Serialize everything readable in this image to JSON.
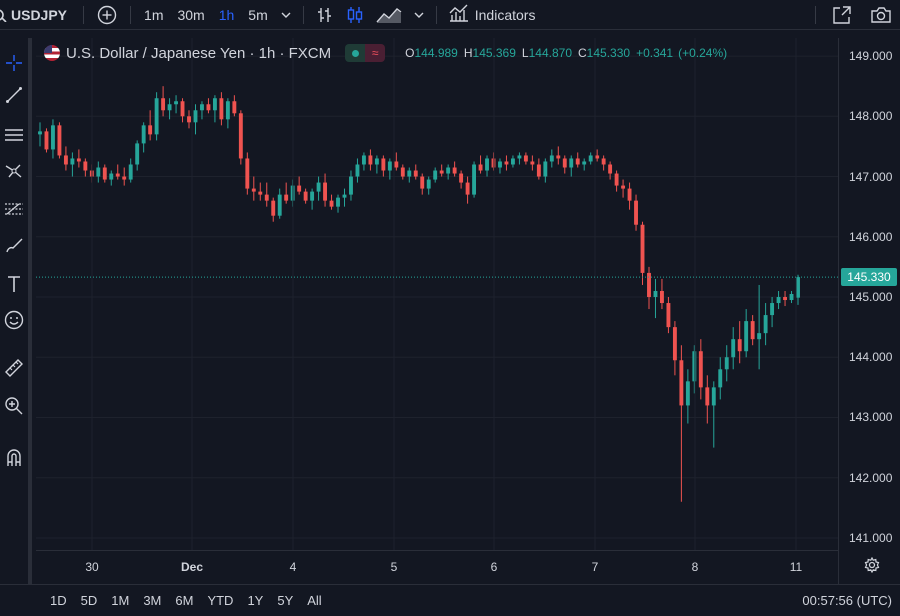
{
  "toolbar": {
    "symbol": "USDJPY",
    "intervals": [
      {
        "label": "1m",
        "active": false
      },
      {
        "label": "30m",
        "active": false
      },
      {
        "label": "1h",
        "active": true
      },
      {
        "label": "5m",
        "active": false
      }
    ],
    "indicators_label": "Indicators",
    "icons": [
      "search-icon",
      "add-symbol-icon",
      "intervals-dropdown-icon",
      "bar-style-icon",
      "candle-style-icon",
      "area-style-icon",
      "chart-style-dropdown-icon",
      "indicators-icon",
      "fullscreen-icon",
      "camera-icon"
    ]
  },
  "left_toolbar": {
    "icons": [
      "crosshair-icon",
      "trend-line-icon",
      "horizontal-lines-icon",
      "pattern-icon",
      "fib-icon",
      "brush-icon",
      "text-icon",
      "emoji-icon",
      "ruler-icon",
      "zoom-icon",
      "magnet-icon"
    ]
  },
  "legend": {
    "title": "U.S. Dollar / Japanese Yen · 1h · FXCM",
    "delay_glyph": "≈",
    "open_label": "O",
    "open": "144.989",
    "high_label": "H",
    "high": "145.369",
    "low_label": "L",
    "low": "144.870",
    "close_label": "C",
    "close": "145.330",
    "change": "+0.341",
    "change_pct": "(+0.24%)"
  },
  "colors": {
    "up": "#26a69a",
    "down": "#ef5350",
    "background": "#131722",
    "grid": "#1e222d",
    "text": "#d1d4dc",
    "accent": "#2962ff"
  },
  "chart_data": {
    "type": "candlestick",
    "title": "U.S. Dollar / Japanese Yen · 1h · FXCM",
    "xlabel": "",
    "ylabel": "",
    "x_ticks": [
      "30",
      "Dec",
      "4",
      "5",
      "6",
      "7",
      "8",
      "11"
    ],
    "y_ticks": [
      "149.000",
      "148.000",
      "147.000",
      "146.000",
      "145.000",
      "144.000",
      "143.000",
      "142.000",
      "141.000"
    ],
    "ylim": [
      140.8,
      149.3
    ],
    "last_price": "145.330",
    "grid": true,
    "series": [
      {
        "o": 147.7,
        "h": 147.9,
        "l": 147.5,
        "c": 147.75
      },
      {
        "o": 147.75,
        "h": 147.8,
        "l": 147.4,
        "c": 147.45
      },
      {
        "o": 147.45,
        "h": 147.95,
        "l": 147.3,
        "c": 147.85
      },
      {
        "o": 147.85,
        "h": 147.9,
        "l": 147.3,
        "c": 147.35
      },
      {
        "o": 147.35,
        "h": 147.5,
        "l": 147.1,
        "c": 147.2
      },
      {
        "o": 147.2,
        "h": 147.4,
        "l": 147.0,
        "c": 147.3
      },
      {
        "o": 147.3,
        "h": 147.45,
        "l": 147.15,
        "c": 147.25
      },
      {
        "o": 147.25,
        "h": 147.3,
        "l": 147.0,
        "c": 147.1
      },
      {
        "o": 147.1,
        "h": 147.2,
        "l": 146.9,
        "c": 147.0
      },
      {
        "o": 147.0,
        "h": 147.25,
        "l": 146.9,
        "c": 147.15
      },
      {
        "o": 147.15,
        "h": 147.2,
        "l": 146.9,
        "c": 146.95
      },
      {
        "o": 146.95,
        "h": 147.1,
        "l": 146.85,
        "c": 147.05
      },
      {
        "o": 147.05,
        "h": 147.2,
        "l": 146.95,
        "c": 147.0
      },
      {
        "o": 147.0,
        "h": 147.15,
        "l": 146.85,
        "c": 146.95
      },
      {
        "o": 146.95,
        "h": 147.3,
        "l": 146.9,
        "c": 147.2
      },
      {
        "o": 147.2,
        "h": 147.6,
        "l": 147.1,
        "c": 147.55
      },
      {
        "o": 147.55,
        "h": 147.9,
        "l": 147.4,
        "c": 147.85
      },
      {
        "o": 147.85,
        "h": 148.1,
        "l": 147.6,
        "c": 147.7
      },
      {
        "o": 147.7,
        "h": 148.4,
        "l": 147.6,
        "c": 148.3
      },
      {
        "o": 148.3,
        "h": 148.5,
        "l": 148.0,
        "c": 148.1
      },
      {
        "o": 148.1,
        "h": 148.3,
        "l": 147.95,
        "c": 148.2
      },
      {
        "o": 148.2,
        "h": 148.35,
        "l": 148.05,
        "c": 148.25
      },
      {
        "o": 148.25,
        "h": 148.3,
        "l": 147.9,
        "c": 148.0
      },
      {
        "o": 148.0,
        "h": 148.1,
        "l": 147.8,
        "c": 147.9
      },
      {
        "o": 147.9,
        "h": 148.2,
        "l": 147.7,
        "c": 148.1
      },
      {
        "o": 148.1,
        "h": 148.25,
        "l": 147.95,
        "c": 148.2
      },
      {
        "o": 148.2,
        "h": 148.3,
        "l": 148.05,
        "c": 148.1
      },
      {
        "o": 148.1,
        "h": 148.35,
        "l": 147.9,
        "c": 148.3
      },
      {
        "o": 148.3,
        "h": 148.4,
        "l": 147.85,
        "c": 147.95
      },
      {
        "o": 147.95,
        "h": 148.3,
        "l": 147.8,
        "c": 148.25
      },
      {
        "o": 148.25,
        "h": 148.35,
        "l": 148.0,
        "c": 148.05
      },
      {
        "o": 148.05,
        "h": 148.1,
        "l": 147.2,
        "c": 147.3
      },
      {
        "o": 147.3,
        "h": 147.4,
        "l": 146.7,
        "c": 146.8
      },
      {
        "o": 146.8,
        "h": 147.0,
        "l": 146.6,
        "c": 146.75
      },
      {
        "o": 146.75,
        "h": 146.9,
        "l": 146.6,
        "c": 146.7
      },
      {
        "o": 146.7,
        "h": 146.9,
        "l": 146.5,
        "c": 146.6
      },
      {
        "o": 146.6,
        "h": 146.65,
        "l": 146.25,
        "c": 146.35
      },
      {
        "o": 146.35,
        "h": 146.8,
        "l": 146.3,
        "c": 146.7
      },
      {
        "o": 146.7,
        "h": 146.9,
        "l": 146.55,
        "c": 146.6
      },
      {
        "o": 146.6,
        "h": 146.95,
        "l": 146.5,
        "c": 146.85
      },
      {
        "o": 146.85,
        "h": 147.0,
        "l": 146.7,
        "c": 146.75
      },
      {
        "o": 146.75,
        "h": 146.8,
        "l": 146.55,
        "c": 146.6
      },
      {
        "o": 146.6,
        "h": 146.8,
        "l": 146.45,
        "c": 146.75
      },
      {
        "o": 146.75,
        "h": 147.0,
        "l": 146.6,
        "c": 146.9
      },
      {
        "o": 146.9,
        "h": 147.05,
        "l": 146.5,
        "c": 146.6
      },
      {
        "o": 146.6,
        "h": 146.7,
        "l": 146.45,
        "c": 146.5
      },
      {
        "o": 146.5,
        "h": 146.7,
        "l": 146.4,
        "c": 146.65
      },
      {
        "o": 146.65,
        "h": 146.8,
        "l": 146.5,
        "c": 146.7
      },
      {
        "o": 146.7,
        "h": 147.1,
        "l": 146.6,
        "c": 147.0
      },
      {
        "o": 147.0,
        "h": 147.3,
        "l": 146.9,
        "c": 147.2
      },
      {
        "o": 147.2,
        "h": 147.4,
        "l": 147.1,
        "c": 147.35
      },
      {
        "o": 147.35,
        "h": 147.45,
        "l": 147.1,
        "c": 147.2
      },
      {
        "o": 147.2,
        "h": 147.35,
        "l": 147.05,
        "c": 147.3
      },
      {
        "o": 147.3,
        "h": 147.35,
        "l": 147.0,
        "c": 147.1
      },
      {
        "o": 147.1,
        "h": 147.3,
        "l": 146.95,
        "c": 147.25
      },
      {
        "o": 147.25,
        "h": 147.4,
        "l": 147.1,
        "c": 147.15
      },
      {
        "o": 147.15,
        "h": 147.2,
        "l": 146.95,
        "c": 147.0
      },
      {
        "o": 147.0,
        "h": 147.15,
        "l": 146.9,
        "c": 147.1
      },
      {
        "o": 147.1,
        "h": 147.2,
        "l": 146.95,
        "c": 147.0
      },
      {
        "o": 147.0,
        "h": 147.05,
        "l": 146.7,
        "c": 146.8
      },
      {
        "o": 146.8,
        "h": 147.0,
        "l": 146.7,
        "c": 146.95
      },
      {
        "o": 146.95,
        "h": 147.15,
        "l": 146.9,
        "c": 147.1
      },
      {
        "o": 147.1,
        "h": 147.2,
        "l": 147.0,
        "c": 147.05
      },
      {
        "o": 147.05,
        "h": 147.2,
        "l": 146.95,
        "c": 147.15
      },
      {
        "o": 147.15,
        "h": 147.25,
        "l": 147.0,
        "c": 147.05
      },
      {
        "o": 147.05,
        "h": 147.1,
        "l": 146.8,
        "c": 146.9
      },
      {
        "o": 146.9,
        "h": 147.0,
        "l": 146.55,
        "c": 146.7
      },
      {
        "o": 146.7,
        "h": 147.25,
        "l": 146.65,
        "c": 147.2
      },
      {
        "o": 147.2,
        "h": 147.35,
        "l": 147.05,
        "c": 147.1
      },
      {
        "o": 147.1,
        "h": 147.35,
        "l": 147.0,
        "c": 147.3
      },
      {
        "o": 147.3,
        "h": 147.4,
        "l": 147.1,
        "c": 147.15
      },
      {
        "o": 147.15,
        "h": 147.3,
        "l": 147.05,
        "c": 147.25
      },
      {
        "o": 147.25,
        "h": 147.35,
        "l": 147.1,
        "c": 147.2
      },
      {
        "o": 147.2,
        "h": 147.35,
        "l": 147.15,
        "c": 147.3
      },
      {
        "o": 147.3,
        "h": 147.4,
        "l": 147.2,
        "c": 147.35
      },
      {
        "o": 147.35,
        "h": 147.4,
        "l": 147.2,
        "c": 147.25
      },
      {
        "o": 147.25,
        "h": 147.35,
        "l": 147.1,
        "c": 147.2
      },
      {
        "o": 147.2,
        "h": 147.3,
        "l": 146.95,
        "c": 147.0
      },
      {
        "o": 147.0,
        "h": 147.3,
        "l": 146.9,
        "c": 147.25
      },
      {
        "o": 147.25,
        "h": 147.45,
        "l": 147.15,
        "c": 147.35
      },
      {
        "o": 147.35,
        "h": 147.5,
        "l": 147.2,
        "c": 147.3
      },
      {
        "o": 147.3,
        "h": 147.35,
        "l": 147.05,
        "c": 147.15
      },
      {
        "o": 147.15,
        "h": 147.35,
        "l": 147.0,
        "c": 147.3
      },
      {
        "o": 147.3,
        "h": 147.4,
        "l": 147.15,
        "c": 147.2
      },
      {
        "o": 147.2,
        "h": 147.3,
        "l": 147.1,
        "c": 147.25
      },
      {
        "o": 147.25,
        "h": 147.4,
        "l": 147.2,
        "c": 147.35
      },
      {
        "o": 147.35,
        "h": 147.45,
        "l": 147.25,
        "c": 147.3
      },
      {
        "o": 147.3,
        "h": 147.35,
        "l": 147.1,
        "c": 147.2
      },
      {
        "o": 147.2,
        "h": 147.25,
        "l": 146.95,
        "c": 147.05
      },
      {
        "o": 147.05,
        "h": 147.1,
        "l": 146.75,
        "c": 146.85
      },
      {
        "o": 146.85,
        "h": 146.95,
        "l": 146.65,
        "c": 146.8
      },
      {
        "o": 146.8,
        "h": 146.9,
        "l": 146.45,
        "c": 146.6
      },
      {
        "o": 146.6,
        "h": 146.7,
        "l": 146.1,
        "c": 146.2
      },
      {
        "o": 146.2,
        "h": 146.25,
        "l": 145.2,
        "c": 145.4
      },
      {
        "o": 145.4,
        "h": 145.5,
        "l": 144.8,
        "c": 145.0
      },
      {
        "o": 145.0,
        "h": 145.3,
        "l": 144.65,
        "c": 145.1
      },
      {
        "o": 145.1,
        "h": 145.3,
        "l": 144.8,
        "c": 144.9
      },
      {
        "o": 144.9,
        "h": 145.0,
        "l": 144.4,
        "c": 144.5
      },
      {
        "o": 144.5,
        "h": 144.6,
        "l": 143.7,
        "c": 143.95
      },
      {
        "o": 143.95,
        "h": 144.2,
        "l": 141.6,
        "c": 143.2
      },
      {
        "o": 143.2,
        "h": 143.8,
        "l": 142.9,
        "c": 143.6
      },
      {
        "o": 143.6,
        "h": 144.2,
        "l": 143.4,
        "c": 144.1
      },
      {
        "o": 144.1,
        "h": 144.3,
        "l": 143.3,
        "c": 143.5
      },
      {
        "o": 143.5,
        "h": 143.7,
        "l": 142.9,
        "c": 143.2
      },
      {
        "o": 143.2,
        "h": 143.6,
        "l": 142.5,
        "c": 143.5
      },
      {
        "o": 143.5,
        "h": 144.0,
        "l": 143.3,
        "c": 143.8
      },
      {
        "o": 143.8,
        "h": 144.2,
        "l": 143.6,
        "c": 144.0
      },
      {
        "o": 144.0,
        "h": 144.5,
        "l": 143.8,
        "c": 144.3
      },
      {
        "o": 144.3,
        "h": 144.6,
        "l": 143.9,
        "c": 144.1
      },
      {
        "o": 144.1,
        "h": 144.8,
        "l": 144.0,
        "c": 144.6
      },
      {
        "o": 144.6,
        "h": 144.7,
        "l": 144.2,
        "c": 144.3
      },
      {
        "o": 144.3,
        "h": 145.2,
        "l": 143.8,
        "c": 144.4
      },
      {
        "o": 144.4,
        "h": 144.9,
        "l": 144.2,
        "c": 144.7
      },
      {
        "o": 144.7,
        "h": 145.0,
        "l": 144.5,
        "c": 144.9
      },
      {
        "o": 144.9,
        "h": 145.1,
        "l": 144.8,
        "c": 145.0
      },
      {
        "o": 145.0,
        "h": 145.1,
        "l": 144.85,
        "c": 144.95
      },
      {
        "o": 144.95,
        "h": 145.1,
        "l": 144.9,
        "c": 145.05
      },
      {
        "o": 144.989,
        "h": 145.369,
        "l": 144.87,
        "c": 145.33
      }
    ]
  },
  "bottom_bar": {
    "ranges": [
      "1D",
      "5D",
      "1M",
      "3M",
      "6M",
      "YTD",
      "1Y",
      "5Y",
      "All"
    ],
    "clock": "00:57:56 (UTC)"
  }
}
